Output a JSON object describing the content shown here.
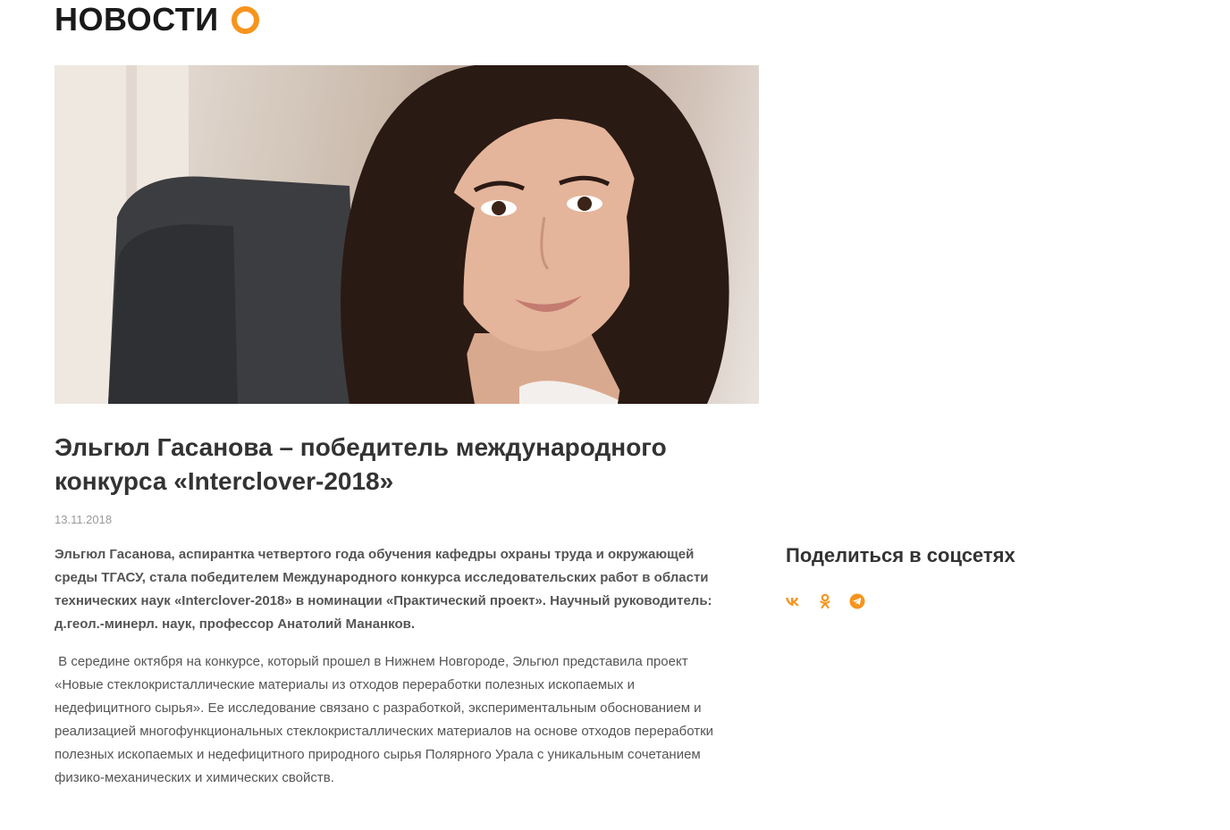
{
  "section": {
    "title": "НОВОСТИ"
  },
  "article": {
    "image_alt": "Эльгюл Гасанова",
    "title": "Эльгюл Гасанова – победитель международного конкурса «Interclover-2018»",
    "date": "13.11.2018",
    "lead": "Эльгюл Гасанова, аспирантка четвертого года обучения кафедры охраны труда и окружающей среды ТГАСУ, стала победителем Международного конкурса исследовательских работ в области технических наук «Interclover-2018» в номинации «Практический проект». Научный руководитель: д.геол.-минерл. наук, профессор Анатолий Мананков.",
    "body": " В середине октября на конкурсе, который прошел в Нижнем Новгороде, Эльгюл представила проект «Новые стеклокристаллические материалы из отходов переработки полезных ископаемых и недефицитного сырья». Ее исследование связано с разработкой, экспериментальным обоснованием и реализацией многофункциональных стеклокристаллических материалов на основе отходов переработки полезных ископаемых и недефицитного природного сырья Полярного Урала с уникальным сочетанием физико-механических и химических свойств."
  },
  "share": {
    "title": "Поделиться в соцсетях",
    "icons": [
      "vk-icon",
      "odnoklassniki-icon",
      "telegram-icon"
    ]
  },
  "colors": {
    "accent": "#f7941d",
    "heading": "#333333",
    "text": "#555555",
    "date": "#9a9a9a"
  }
}
